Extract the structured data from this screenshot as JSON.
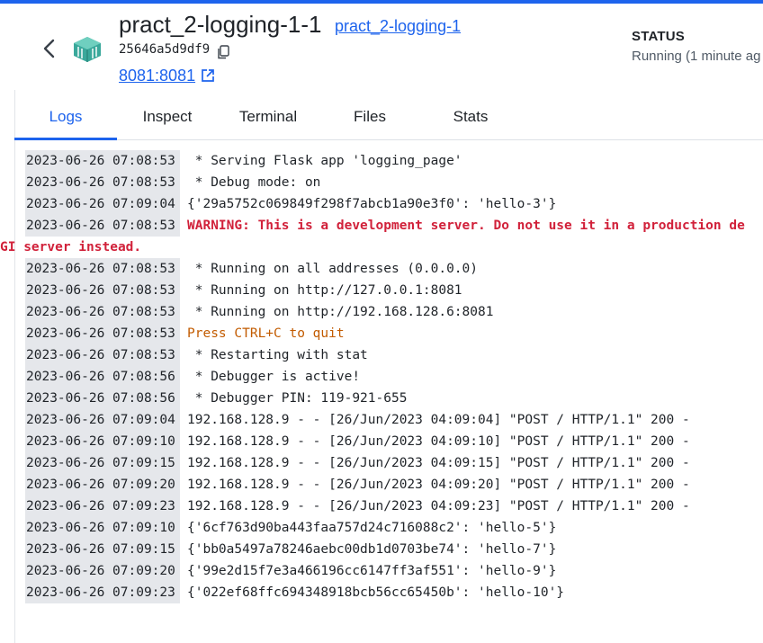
{
  "header": {
    "title": "pract_2-logging-1-1",
    "project_link": "pract_2-logging-1",
    "container_id": "25646a5d9df9",
    "port_link": "8081:8081",
    "status_label": "STATUS",
    "status_value": "Running (1 minute ag"
  },
  "tabs": [
    {
      "label": "Logs",
      "active": true
    },
    {
      "label": "Inspect",
      "active": false
    },
    {
      "label": "Terminal",
      "active": false
    },
    {
      "label": "Files",
      "active": false
    },
    {
      "label": "Stats",
      "active": false
    }
  ],
  "logs": [
    {
      "ts": "2023-06-26 07:08:53",
      "msg": " * Serving Flask app 'logging_page'",
      "style": "normal"
    },
    {
      "ts": "2023-06-26 07:08:53",
      "msg": " * Debug mode: on",
      "style": "normal"
    },
    {
      "ts": "2023-06-26 07:09:04",
      "msg": "{'29a5752c069849f298f7abcb1a90e3f0': 'hello-3'}",
      "style": "normal"
    },
    {
      "ts": "2023-06-26 07:08:53",
      "msg": "WARNING: This is a development server. Do not use it in a production de",
      "style": "warn"
    },
    {
      "ts": "",
      "msg": "GI server instead.",
      "style": "warn-cont"
    },
    {
      "ts": "2023-06-26 07:08:53",
      "msg": " * Running on all addresses (0.0.0.0)",
      "style": "normal"
    },
    {
      "ts": "2023-06-26 07:08:53",
      "msg": " * Running on http://127.0.0.1:8081",
      "style": "normal"
    },
    {
      "ts": "2023-06-26 07:08:53",
      "msg": " * Running on http://192.168.128.6:8081",
      "style": "normal"
    },
    {
      "ts": "2023-06-26 07:08:53",
      "msg": "Press CTRL+C to quit",
      "style": "amber"
    },
    {
      "ts": "2023-06-26 07:08:53",
      "msg": " * Restarting with stat",
      "style": "normal"
    },
    {
      "ts": "2023-06-26 07:08:56",
      "msg": " * Debugger is active!",
      "style": "normal"
    },
    {
      "ts": "2023-06-26 07:08:56",
      "msg": " * Debugger PIN: 119-921-655",
      "style": "normal"
    },
    {
      "ts": "2023-06-26 07:09:04",
      "msg": "192.168.128.9 - - [26/Jun/2023 04:09:04] \"POST / HTTP/1.1\" 200 -",
      "style": "normal"
    },
    {
      "ts": "2023-06-26 07:09:10",
      "msg": "192.168.128.9 - - [26/Jun/2023 04:09:10] \"POST / HTTP/1.1\" 200 -",
      "style": "normal"
    },
    {
      "ts": "2023-06-26 07:09:15",
      "msg": "192.168.128.9 - - [26/Jun/2023 04:09:15] \"POST / HTTP/1.1\" 200 -",
      "style": "normal"
    },
    {
      "ts": "2023-06-26 07:09:20",
      "msg": "192.168.128.9 - - [26/Jun/2023 04:09:20] \"POST / HTTP/1.1\" 200 -",
      "style": "normal"
    },
    {
      "ts": "2023-06-26 07:09:23",
      "msg": "192.168.128.9 - - [26/Jun/2023 04:09:23] \"POST / HTTP/1.1\" 200 -",
      "style": "normal"
    },
    {
      "ts": "2023-06-26 07:09:10",
      "msg": "{'6cf763d90ba443faa757d24c716088c2': 'hello-5'}",
      "style": "normal"
    },
    {
      "ts": "2023-06-26 07:09:15",
      "msg": "{'bb0a5497a78246aebc00db1d0703be74': 'hello-7'}",
      "style": "normal"
    },
    {
      "ts": "2023-06-26 07:09:20",
      "msg": "{'99e2d15f7e3a466196cc6147ff3af551': 'hello-9'}",
      "style": "normal"
    },
    {
      "ts": "2023-06-26 07:09:23",
      "msg": "{'022ef68ffc694348918bcb56cc65450b': 'hello-10'}",
      "style": "normal"
    }
  ],
  "colors": {
    "accent": "#1d63ed",
    "warning": "#d1213a",
    "notice": "#c25b00",
    "timestamp_bg": "#e5e7eb"
  },
  "icons": {
    "back": "chevron-left-icon",
    "container": "container-cube-icon",
    "copy": "copy-icon",
    "external": "external-link-icon"
  }
}
